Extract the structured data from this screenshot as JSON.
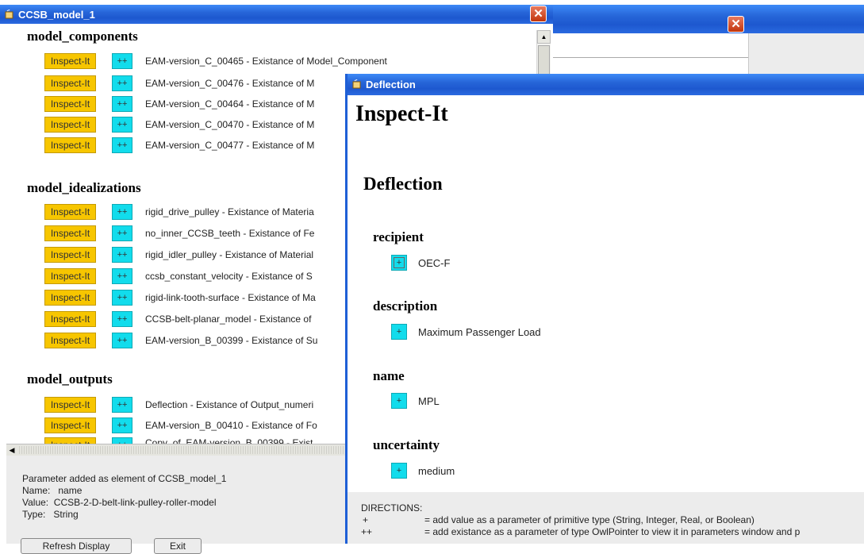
{
  "main_window": {
    "title": "CCSB_model_1",
    "sections": [
      {
        "heading": "model_components",
        "rows": [
          "EAM-version_C_00465 - Existance of Model_Component",
          "EAM-version_C_00476 - Existance of M",
          "EAM-version_C_00464 - Existance of M",
          "EAM-version_C_00470 - Existance of M",
          "EAM-version_C_00477 - Existance of M"
        ]
      },
      {
        "heading": "model_idealizations",
        "rows": [
          "rigid_drive_pulley - Existance of Materia",
          "no_inner_CCSB_teeth - Existance of Fe",
          "rigid_idler_pulley - Existance of Material",
          "ccsb_constant_velocity - Existance of S",
          "rigid-link-tooth-surface - Existance of Ma",
          "CCSB-belt-planar_model - Existance of",
          "EAM-version_B_00399 - Existance of Su"
        ]
      },
      {
        "heading": "model_outputs",
        "rows": [
          "Deflection - Existance of Output_numeri",
          "EAM-version_B_00410 - Existance of Fo",
          "Copy_of_EAM-version_B_00399 - Exist"
        ]
      }
    ],
    "inspect_label": "Inspect-It",
    "plusplus_label": "++",
    "status": {
      "line1": "Parameter added as element of CCSB_model_1",
      "line2": "Name:   name",
      "line3": "Value:  CCSB-2-D-belt-link-pulley-roller-model",
      "line4": "Type:   String"
    },
    "bottom_buttons": [
      "Refresh Display",
      "Exit"
    ]
  },
  "deflection_window": {
    "title": "Deflection",
    "heading": "Inspect-It",
    "subheading": "Deflection",
    "plus_label": "+",
    "properties": [
      {
        "name": "recipient",
        "value": "OEC-F"
      },
      {
        "name": "description",
        "value": "Maximum Passenger Load"
      },
      {
        "name": "name",
        "value": "MPL"
      },
      {
        "name": "uncertainty",
        "value": "medium"
      }
    ],
    "directions": {
      "title": "DIRECTIONS:",
      "plus_sym": "+",
      "plus_text": "= add value as a parameter of primitive type (String, Integer, Real, or Boolean)",
      "pp_sym": "++",
      "pp_text": "= add existance as a parameter of type OwlPointer to view it in parameters window and p"
    }
  },
  "colors": {
    "titlebar": "#2665d8",
    "inspect_button": "#f7c600",
    "plus_button": "#12dcec",
    "close_button": "#c2350c"
  }
}
